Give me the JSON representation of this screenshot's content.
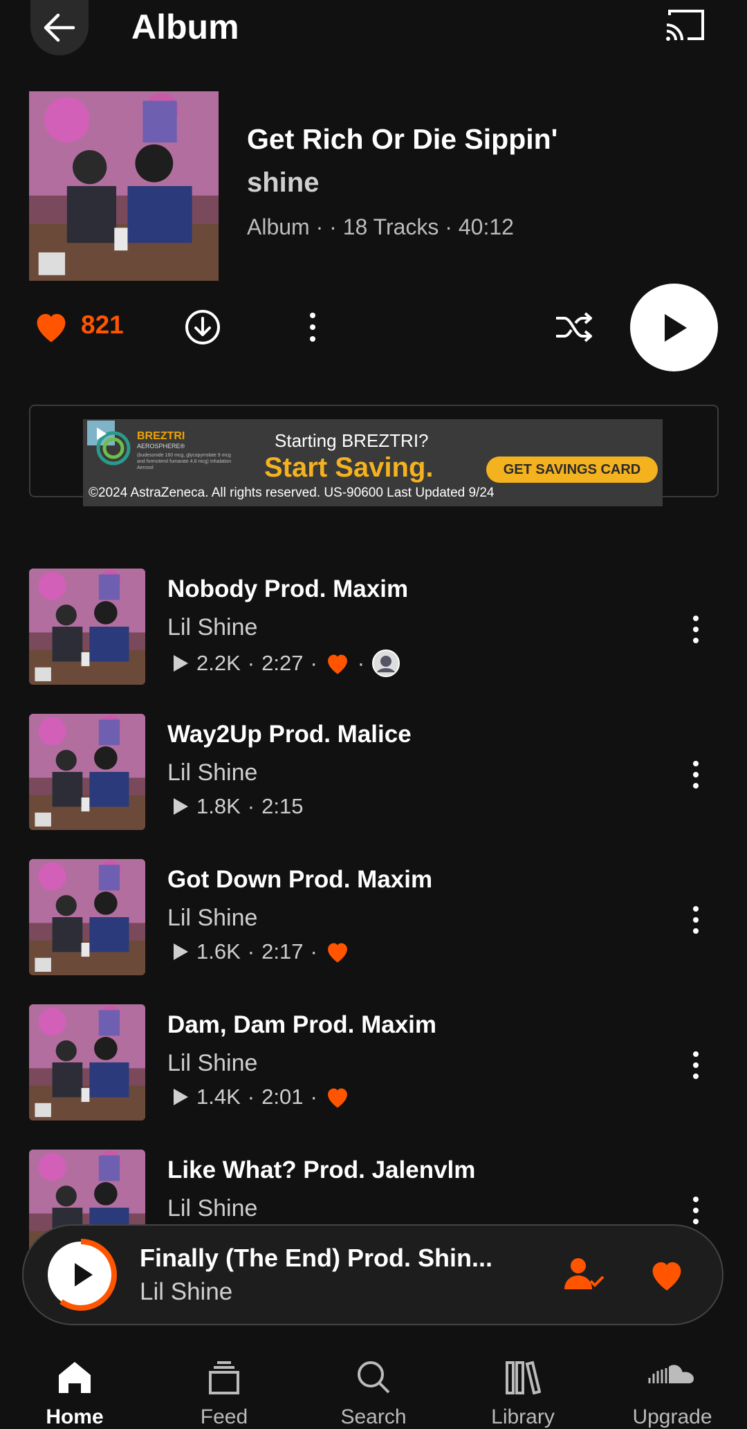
{
  "header": {
    "title": "Album",
    "back_icon": "arrow-left-icon",
    "cast_icon": "cast-icon"
  },
  "album": {
    "title": "Get Rich Or Die Sippin'",
    "artist": "shine",
    "meta": "Album ·  · 18 Tracks · 40:12"
  },
  "actions": {
    "like_count": "821",
    "accent": "#ff5500"
  },
  "ad": {
    "brand": "BREZTRI",
    "brand_sub": "AEROSPHERE®",
    "note": "(budesonide 160 mcg, glycopyrrolate 9 mcg and formoterol fumarate 4.8 mcg) Inhalation Aerosol",
    "question": "Starting BREZTRI?",
    "cta": "Start Saving.",
    "card": "GET SAVINGS CARD",
    "copyright": "©2024 AstraZeneca. All rights reserved. US-90600 Last Updated 9/24"
  },
  "tracks": [
    {
      "title": "Nobody Prod. Maxim",
      "artist": "Lil Shine",
      "plays": "2.2K",
      "duration": "2:27",
      "liked": true,
      "avatar": true
    },
    {
      "title": "Way2Up Prod. Malice",
      "artist": "Lil Shine",
      "plays": "1.8K",
      "duration": "2:15",
      "liked": false,
      "avatar": false
    },
    {
      "title": "Got Down Prod. Maxim",
      "artist": "Lil Shine",
      "plays": "1.6K",
      "duration": "2:17",
      "liked": true,
      "avatar": false
    },
    {
      "title": "Dam, Dam Prod. Maxim",
      "artist": "Lil Shine",
      "plays": "1.4K",
      "duration": "2:01",
      "liked": true,
      "avatar": false
    },
    {
      "title": "Like What? Prod. Jalenvlm",
      "artist": "Lil Shine"
    }
  ],
  "mini_player": {
    "title": "Finally (The End) Prod. Shin...",
    "artist": "Lil Shine",
    "progress": 0.6
  },
  "nav": [
    {
      "label": "Home",
      "icon": "home-icon",
      "active": true
    },
    {
      "label": "Feed",
      "icon": "feed-icon",
      "active": false
    },
    {
      "label": "Search",
      "icon": "search-icon",
      "active": false
    },
    {
      "label": "Library",
      "icon": "library-icon",
      "active": false
    },
    {
      "label": "Upgrade",
      "icon": "soundcloud-icon",
      "active": false
    }
  ]
}
